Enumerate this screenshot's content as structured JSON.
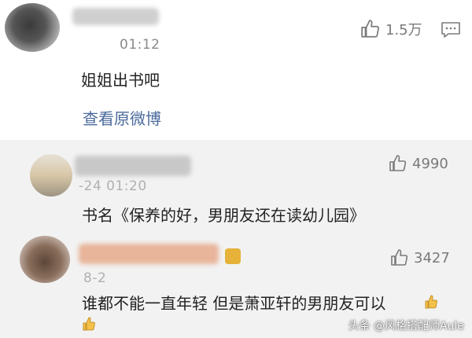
{
  "comments": [
    {
      "time": "01:12",
      "text": "姐姐出书吧",
      "likes": "1.5万",
      "link": "查看原微博"
    },
    {
      "time": "-24 01:20",
      "text": "书名《保养的好，男朋友还在读幼儿园》",
      "likes": "4990"
    },
    {
      "time": "8-2",
      "text": "谁都不能一直年轻 但是萧亚轩的男朋友可以",
      "likes": "3427"
    }
  ],
  "watermark": "头条 @风格搭配师Aule",
  "icons": {
    "like": "thumbs-up-icon",
    "more": "comment-more-icon",
    "emoji": "thumbs-up-emoji"
  },
  "colors": {
    "link": "#4a6a9c",
    "meta": "#8a8a8a"
  }
}
